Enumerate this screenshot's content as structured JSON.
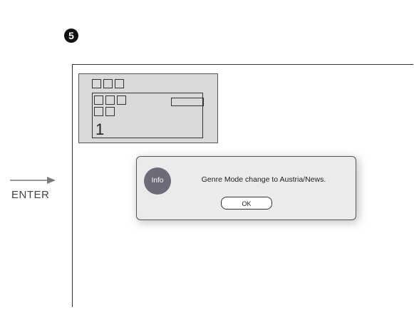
{
  "step": {
    "number": "5"
  },
  "transition": {
    "label": "ENTER"
  },
  "display": {
    "channel_digit": "1"
  },
  "dialog": {
    "icon_label": "Info",
    "message": "Genre Mode change to Austria/News.",
    "ok_label": "OK"
  }
}
